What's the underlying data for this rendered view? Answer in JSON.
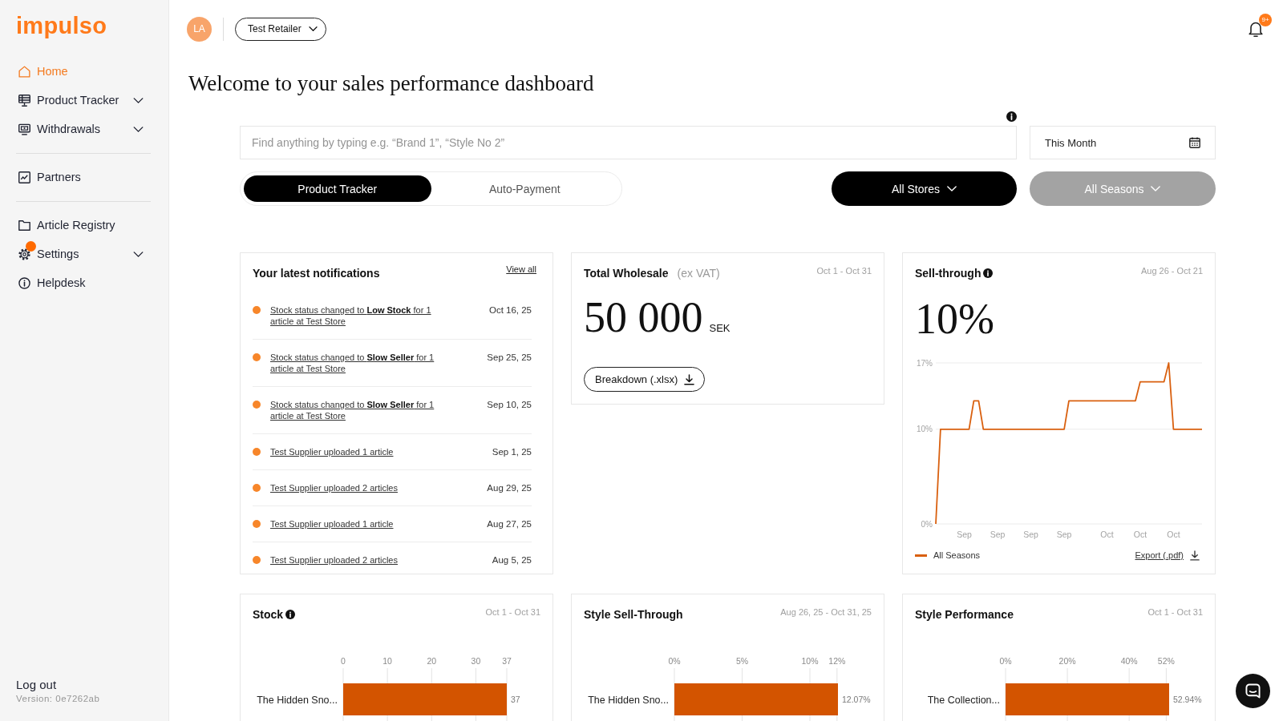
{
  "sidebar": {
    "logo": "impulso",
    "sections": [
      {
        "items": [
          {
            "label": "Home",
            "selected": true,
            "submenu": false,
            "alert": false
          },
          {
            "label": "Product Tracker",
            "selected": false,
            "submenu": true,
            "alert": false
          },
          {
            "label": "Withdrawals",
            "selected": false,
            "submenu": true,
            "alert": false
          }
        ]
      },
      {
        "items": [
          {
            "label": "Partners",
            "selected": false,
            "submenu": false,
            "alert": false
          }
        ]
      },
      {
        "items": [
          {
            "label": "Article Registry",
            "selected": false,
            "submenu": false,
            "alert": false
          },
          {
            "label": "Settings",
            "selected": false,
            "submenu": true,
            "alert": true
          },
          {
            "label": "Helpdesk",
            "selected": false,
            "submenu": false,
            "alert": false
          }
        ]
      }
    ],
    "footer": {
      "logout": "Log out",
      "version": "Version: 0e7262ab"
    }
  },
  "header": {
    "avatar": "LA",
    "account": "Test Retailer",
    "notifications_count": "9+"
  },
  "title": "Welcome to your sales performance dashboard",
  "filters": {
    "search": {
      "placeholder": "Find anything by typing e.g. “Brand 1”, “Style No 2”"
    },
    "date": {
      "value": "This Month"
    },
    "tabs": [
      {
        "label": "Product Tracker",
        "selected": true
      },
      {
        "label": "Auto-Payment",
        "selected": false
      }
    ],
    "store_select": {
      "label": "All Stores",
      "disabled": false
    },
    "season_select": {
      "label": "All Seasons",
      "disabled": true
    }
  },
  "cards": [
    {
      "kind": "notifications",
      "title": "Your latest notifications",
      "info": false,
      "link": "View all",
      "items": [
        {
          "text": "Stock status changed to **Low Stock** for 1 article at Test Store",
          "date": "Oct 16, 25",
          "unread": true
        },
        {
          "text": "Stock status changed to **Slow Seller** for 1 article at Test Store",
          "date": "Sep 25, 25",
          "unread": true
        },
        {
          "text": "Stock status changed to **Slow Seller** for 1 article at Test Store",
          "date": "Sep 10, 25",
          "unread": true
        },
        {
          "text": "Test Supplier uploaded 1 article",
          "date": "Sep 1, 25",
          "unread": true
        },
        {
          "text": "Test Supplier uploaded 2 articles",
          "date": "Aug 29, 25",
          "unread": true
        },
        {
          "text": "Test Supplier uploaded 1 article",
          "date": "Aug 27, 25",
          "unread": true
        },
        {
          "text": "Test Supplier uploaded 2 articles",
          "date": "Aug 5, 25",
          "unread": true
        }
      ]
    },
    {
      "kind": "metric",
      "title": "Total Wholesale",
      "subtitle": "(ex VAT)",
      "info": false,
      "range": "Oct 1 - Oct 31",
      "value": "50 000",
      "unit": "SEK",
      "button": "Breakdown (.xlsx)"
    },
    {
      "kind": "trend",
      "title": "Sell-through",
      "info": true,
      "range": "Aug 26 - Oct 21",
      "value": "10%",
      "link": "Export (.pdf)",
      "chart_data": {
        "type": "line",
        "grid": true,
        "categories": [
          null,
          null,
          null,
          null,
          null,
          null,
          "Sep",
          null,
          null,
          null,
          null,
          null,
          null,
          "Sep",
          null,
          null,
          null,
          null,
          null,
          null,
          "Sep",
          null,
          null,
          null,
          null,
          null,
          null,
          "Sep",
          null,
          null,
          null,
          null,
          null,
          null,
          null,
          null,
          "Oct",
          null,
          null,
          null,
          null,
          null,
          null,
          "Oct",
          null,
          null,
          null,
          null,
          null,
          null,
          "Oct",
          null,
          null,
          null,
          null,
          null,
          null
        ],
        "series": [
          {
            "name": "All Seasons",
            "color": "#d9600f",
            "values": [
              0,
              10,
              10,
              10,
              10,
              10,
              10,
              10,
              13,
              13,
              10,
              10,
              10,
              10,
              10,
              10,
              10,
              10,
              10,
              10,
              10,
              10,
              10,
              10,
              10,
              10,
              10,
              10,
              13,
              13,
              13,
              13,
              13,
              13,
              13,
              13,
              13,
              13,
              13,
              13,
              13,
              13,
              13,
              15,
              15,
              15,
              15,
              15,
              15,
              17,
              10,
              10,
              10,
              10,
              10,
              10,
              10
            ]
          }
        ],
        "ylim": [
          0,
          17
        ],
        "yticks": [
          {
            "value": 0,
            "label": "0%"
          },
          {
            "value": 10,
            "label": "10%"
          },
          {
            "value": 17,
            "label": "17%"
          }
        ]
      }
    },
    {
      "kind": "bars",
      "title": "Stock",
      "info": true,
      "range": "Oct 1 - Oct 31",
      "chart_data": {
        "type": "bar",
        "orientation": "horizontal",
        "grid": true,
        "categories": [
          "The Hidden Sno..."
        ],
        "values": [
          37
        ],
        "xlim": [
          0,
          37
        ],
        "xticks": [
          0,
          10,
          20,
          30,
          37
        ],
        "value_labels": [
          "37"
        ]
      }
    },
    {
      "kind": "bars",
      "title": "Style Sell-Through",
      "info": false,
      "range": "Aug 26, 25 - Oct 31, 25",
      "chart_data": {
        "type": "bar",
        "orientation": "horizontal",
        "grid": true,
        "categories": [
          "The Hidden Sno..."
        ],
        "values": [
          12.07
        ],
        "xlim": [
          0,
          12.07
        ],
        "xticks": [
          {
            "value": 0,
            "label": "0%"
          },
          {
            "value": 5,
            "label": "5%"
          },
          {
            "value": 10,
            "label": "10%"
          },
          {
            "value": 12,
            "label": "12%"
          }
        ],
        "value_labels": [
          "12.07%"
        ]
      }
    },
    {
      "kind": "bars",
      "title": "Style Performance",
      "info": false,
      "range": "Oct 1 - Oct 31",
      "chart_data": {
        "type": "bar",
        "orientation": "horizontal",
        "grid": true,
        "categories": [
          "The Collection..."
        ],
        "values": [
          52.94
        ],
        "xlim": [
          0,
          52.94
        ],
        "xticks": [
          {
            "value": 0,
            "label": "0%"
          },
          {
            "value": 20,
            "label": "20%"
          },
          {
            "value": 40,
            "label": "40%"
          },
          {
            "value": 52,
            "label": "52%"
          }
        ],
        "value_labels": [
          "52.94%"
        ]
      }
    }
  ]
}
